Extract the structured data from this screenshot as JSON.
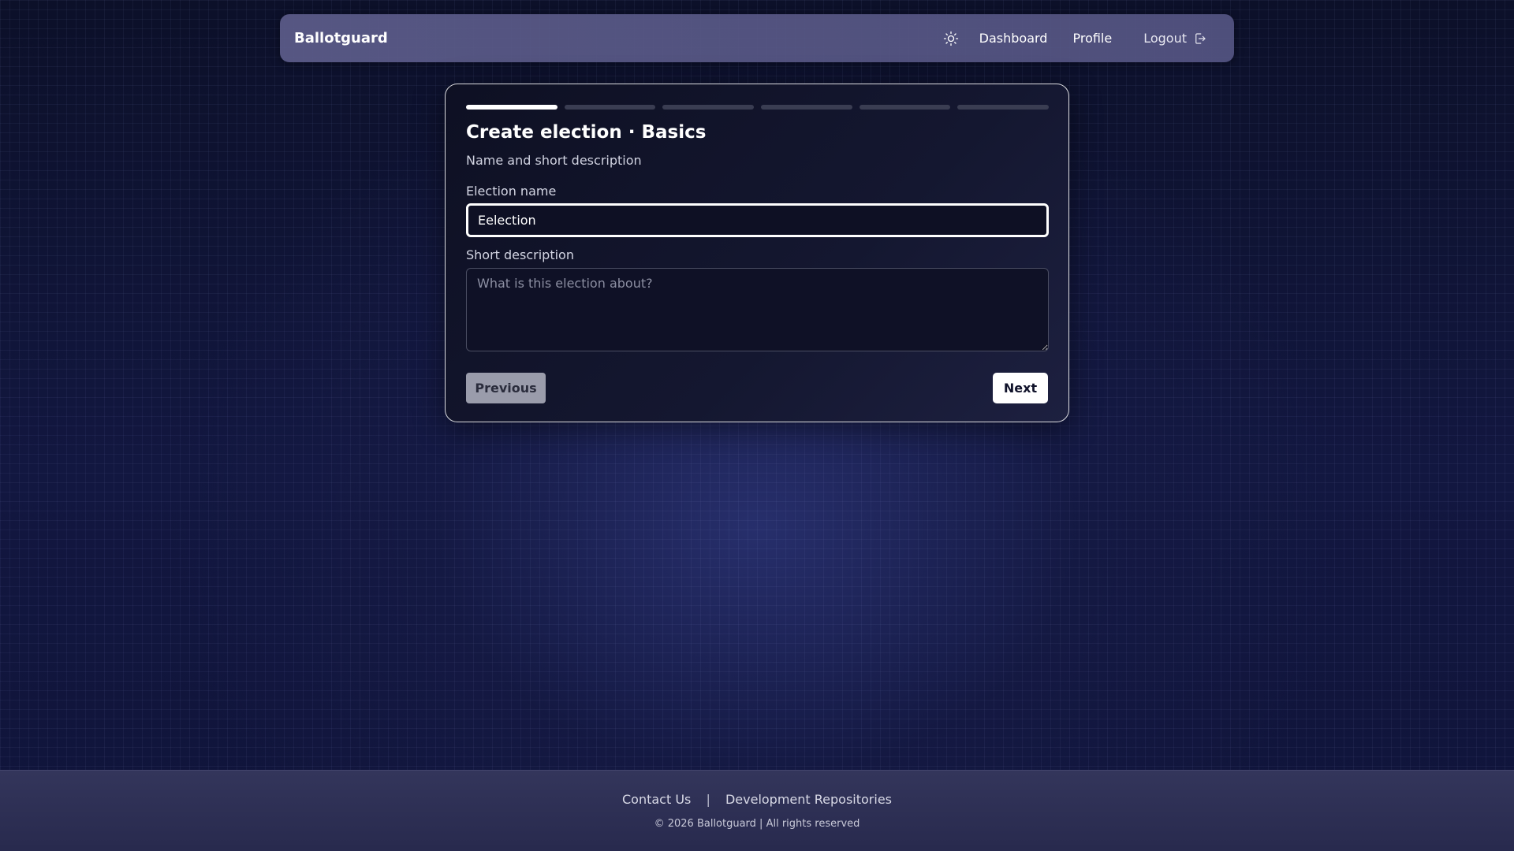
{
  "navbar": {
    "brand": "Ballotguard",
    "theme_icon": "sun-icon",
    "links": {
      "dashboard": "Dashboard",
      "profile": "Profile",
      "logout": "Logout"
    },
    "logout_icon": "logout-icon"
  },
  "wizard": {
    "total_steps": 6,
    "current_step": 1,
    "title": "Create election · Basics",
    "subtitle": "Name and short description",
    "fields": {
      "name_label": "Election name",
      "name_value": "Eelection",
      "description_label": "Short description",
      "description_placeholder": "What is this election about?",
      "description_value": ""
    },
    "buttons": {
      "previous": "Previous",
      "next": "Next"
    }
  },
  "footer": {
    "contact": "Contact Us",
    "separator": "|",
    "repos": "Development Repositories",
    "copyright": "© 2026 Ballotguard | All rights reserved"
  },
  "colors": {
    "background": "#0e1230",
    "navbar": "#5c5c8a",
    "card": "#12142b",
    "accent": "#ffffff",
    "footer": "#34365c"
  }
}
